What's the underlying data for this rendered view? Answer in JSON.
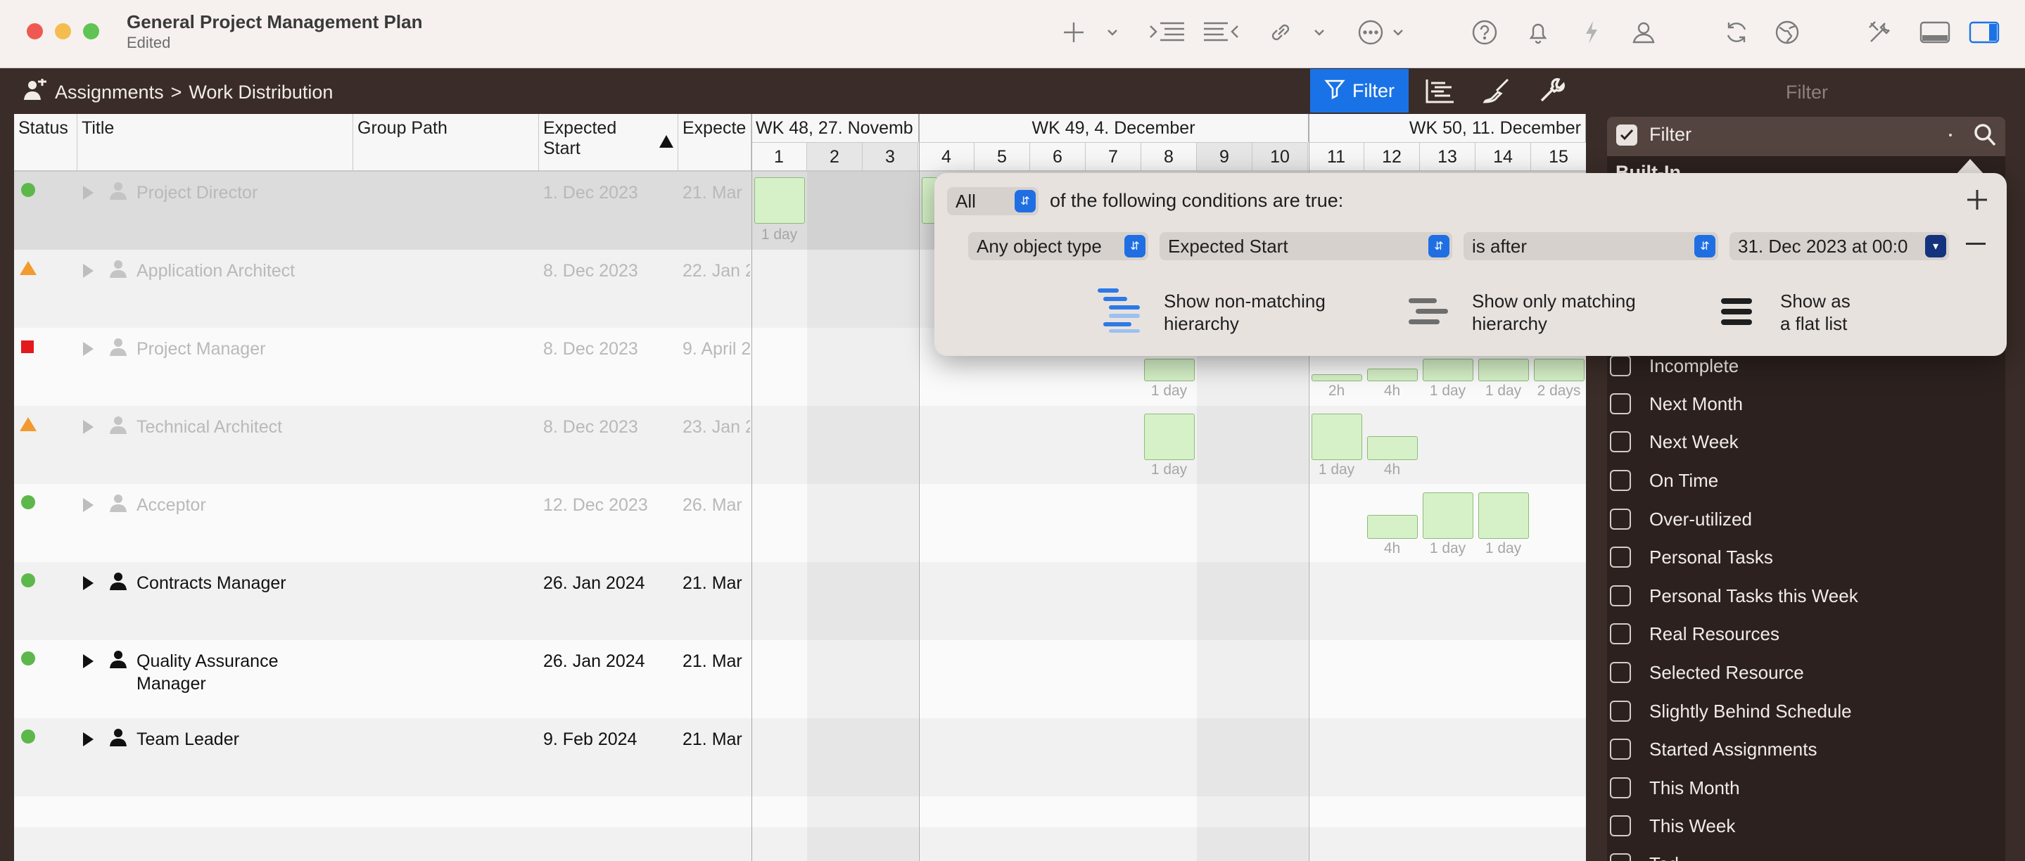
{
  "window": {
    "title": "General Project Management Plan",
    "subtitle": "Edited",
    "colors": {
      "close": "#ee5a52",
      "minimize": "#f5bd4f",
      "zoom": "#5fc454",
      "accent": "#1a73e6"
    }
  },
  "toolbar": {
    "icons": [
      "plus-icon",
      "chevron-down-icon",
      "indent-icon",
      "outdent-icon",
      "link-icon",
      "chevron-down-icon",
      "more-icon",
      "chevron-down-icon",
      "help-icon",
      "bell-icon",
      "bolt-icon",
      "person-icon",
      "refresh-icon",
      "globe-icon",
      "tools-icon",
      "bottom-panel-icon",
      "right-panel-icon"
    ]
  },
  "breadcrumb": {
    "root": "Assignments",
    "separator": ">",
    "current": "Work Distribution"
  },
  "view_toolbar": {
    "filter_label": "Filter",
    "sidebar_title": "Filter"
  },
  "grid": {
    "columns": {
      "status": "Status",
      "title": "Title",
      "group_path": "Group Path",
      "expected_start": "Expected Start",
      "expected_end": "Expecte"
    },
    "weeks": [
      "WK 48, 27. Novemb",
      "WK 49, 4. December",
      "WK 50, 11. December"
    ],
    "days": [
      "1",
      "2",
      "3",
      "4",
      "5",
      "6",
      "7",
      "8",
      "9",
      "10",
      "11",
      "12",
      "13",
      "14",
      "15"
    ],
    "rows": [
      {
        "status": "green",
        "title": "Project Director",
        "start": "1. Dec 2023",
        "end": "21. Mar",
        "dimmed": true
      },
      {
        "status": "orange",
        "title": "Application Architect",
        "start": "8. Dec 2023",
        "end": "22. Jan 2",
        "dimmed": true
      },
      {
        "status": "red",
        "title": "Project Manager",
        "start": "8. Dec 2023",
        "end": "9. April 2",
        "dimmed": true
      },
      {
        "status": "orange",
        "title": "Technical Architect",
        "start": "8. Dec 2023",
        "end": "23. Jan 2",
        "dimmed": true
      },
      {
        "status": "green",
        "title": "Acceptor",
        "start": "12. Dec 2023",
        "end": "26. Mar",
        "dimmed": true
      },
      {
        "status": "green",
        "title": "Contracts Manager",
        "start": "26. Jan 2024",
        "end": "21. Mar",
        "dimmed": false
      },
      {
        "status": "green",
        "title": "Quality Assurance",
        "title2": "Manager",
        "start": "26. Jan 2024",
        "end": "21. Mar",
        "dimmed": false
      },
      {
        "status": "green",
        "title": "Team Leader",
        "start": "9. Feb 2024",
        "end": "21. Mar",
        "dimmed": false
      }
    ],
    "bar_labels": {
      "r1_d1": "1 day",
      "r3_d8": "1 day",
      "r3_d11": "2h",
      "r3_d12": "4h",
      "r3_d13": "1 day",
      "r3_d14": "1 day",
      "r3_d15": "2 days",
      "r4_d8": "1 day",
      "r4_d11": "1 day",
      "r4_d12": "4h",
      "r5_d12": "4h",
      "r5_d13": "1 day",
      "r5_d14": "1 day"
    }
  },
  "filter_popover": {
    "match_mode": "All",
    "conditions_text": "of the following conditions are true:",
    "object_type": "Any object type",
    "field": "Expected Start",
    "operator": "is after",
    "value": "31. Dec 2023 at 00:0",
    "options": [
      {
        "line1": "Show non-matching",
        "line2": "hierarchy"
      },
      {
        "line1": "Show only matching",
        "line2": "hierarchy"
      },
      {
        "line1": "Show as",
        "line2": "a flat list"
      }
    ]
  },
  "sidebar": {
    "header_label": "Filter",
    "section": "Built-In",
    "items": [
      "Incomplete",
      "Next Month",
      "Next Week",
      "On Time",
      "Over-utilized",
      "Personal Tasks",
      "Personal Tasks this Week",
      "Real Resources",
      "Selected Resource",
      "Slightly Behind Schedule",
      "Started Assignments",
      "This Month",
      "This Week",
      "Tod"
    ]
  }
}
